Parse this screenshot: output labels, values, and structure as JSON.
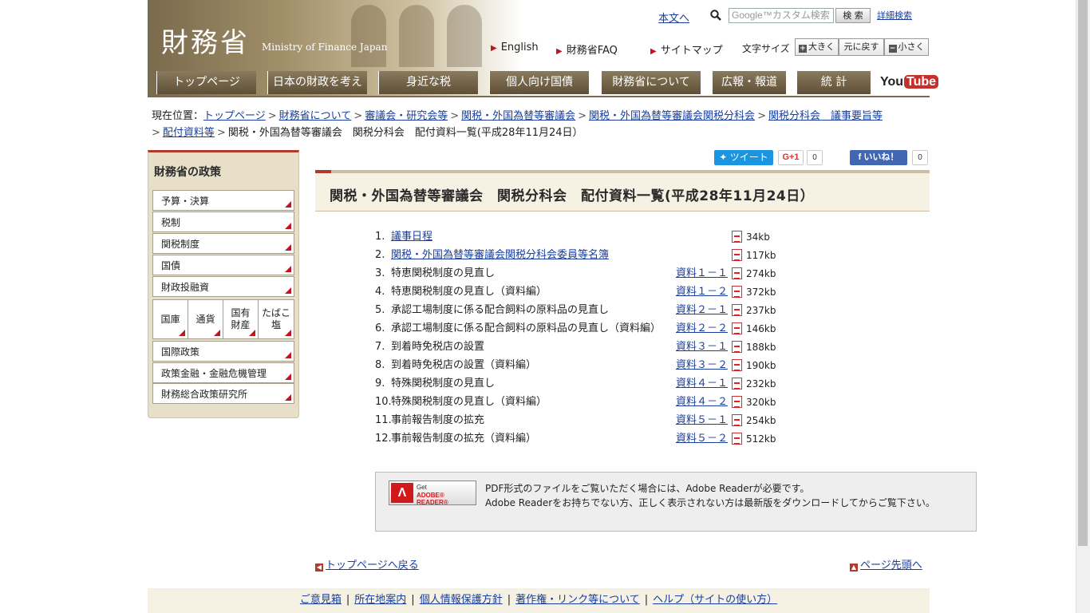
{
  "header": {
    "logo_jp": "財務省",
    "logo_en": "Ministry of Finance Japan",
    "skip_link": "本文へ",
    "search_placeholder": "Google™カスタム検索",
    "search_button": "検 索",
    "advanced_search": "詳細検索",
    "util_links": [
      "English",
      "財務省FAQ",
      "サイトマップ"
    ],
    "font_size_label": "文字サイズ",
    "font_buttons": [
      "大きく",
      "元に戻す",
      "小さく"
    ]
  },
  "nav": {
    "items": [
      "トップページ",
      "日本の財政を考える",
      "身近な税",
      "個人向け国債",
      "財務省について",
      "広報・報道",
      "統 計"
    ],
    "youtube": "You",
    "youtube_tube": "Tube"
  },
  "breadcrumb": {
    "label": "現在位置：",
    "links": [
      "トップページ",
      "財務省について",
      "審議会・研究会等",
      "関税・外国為替等審議会",
      "関税・外国為替等審議会関税分科会",
      "関税分科会　議事要旨等",
      "配付資料等"
    ],
    "current": "関税・外国為替等審議会　関税分科会　配付資料一覧(平成28年11月24日）"
  },
  "sidebar": {
    "title": "財務省の政策",
    "items": [
      "予算・決算",
      "税制",
      "関税制度",
      "国債",
      "財政投融資"
    ],
    "grid": [
      "国庫",
      "通貨",
      "国有\n財産",
      "たばこ\n塩"
    ],
    "items2": [
      "国際政策",
      "政策金融・金融危機管理",
      "財務総合政策研究所"
    ]
  },
  "social": {
    "tweet": "ツイート",
    "gplus": "G+1",
    "gplus_count": "0",
    "like": "いいね！",
    "like_count": "0"
  },
  "main": {
    "title": "関税・外国為替等審議会　関税分科会　配付資料一覧(平成28年11月24日）",
    "documents": [
      {
        "num": "1.",
        "title": "議事日程",
        "link_title": true,
        "doc": "",
        "size": "34kb"
      },
      {
        "num": "2.",
        "title": "関税・外国為替等審議会関税分科会委員等名簿",
        "link_title": true,
        "doc": "",
        "size": "117kb"
      },
      {
        "num": "3.",
        "title": "特恵関税制度の見直し",
        "link_title": false,
        "doc": "資料１－１",
        "size": "274kb"
      },
      {
        "num": "4.",
        "title": "特恵関税制度の見直し（資料編）",
        "link_title": false,
        "doc": "資料１－２",
        "size": "372kb"
      },
      {
        "num": "5.",
        "title": "承認工場制度に係る配合飼料の原料品の見直し",
        "link_title": false,
        "doc": "資料２－１",
        "size": "237kb"
      },
      {
        "num": "6.",
        "title": "承認工場制度に係る配合飼料の原料品の見直し（資料編）",
        "link_title": false,
        "doc": "資料２－２",
        "size": "146kb"
      },
      {
        "num": "7.",
        "title": "到着時免税店の設置",
        "link_title": false,
        "doc": "資料３－１",
        "size": "188kb"
      },
      {
        "num": "8.",
        "title": "到着時免税店の設置（資料編）",
        "link_title": false,
        "doc": "資料３－２",
        "size": "190kb"
      },
      {
        "num": "9.",
        "title": "特殊関税制度の見直し",
        "link_title": false,
        "doc": "資料４－１",
        "size": "232kb"
      },
      {
        "num": "10.",
        "title": "特殊関税制度の見直し（資料編）",
        "link_title": false,
        "doc": "資料４－２",
        "size": "320kb"
      },
      {
        "num": "11.",
        "title": "事前報告制度の拡充",
        "link_title": false,
        "doc": "資料５－１",
        "size": "254kb"
      },
      {
        "num": "12.",
        "title": "事前報告制度の拡充（資料編）",
        "link_title": false,
        "doc": "資料５－２",
        "size": "512kb"
      }
    ],
    "adobe": {
      "get": "Get",
      "reader": "ADOBE® READER®",
      "line1": "PDF形式のファイルをご覧いただく場合には、Adobe Readerが必要です。",
      "line2": "Adobe Readerをお持ちでない方、正しく表示されない方は最新版をダウンロードしてからご覧下さい。"
    },
    "back_top": "トップページへ戻る",
    "page_top": "ページ先頭へ"
  },
  "footer": {
    "links": [
      "ご意見箱",
      "所在地案内",
      "個人情報保護方針",
      "著作権・リンク等について",
      "ヘルプ（サイトの使い方）"
    ]
  }
}
